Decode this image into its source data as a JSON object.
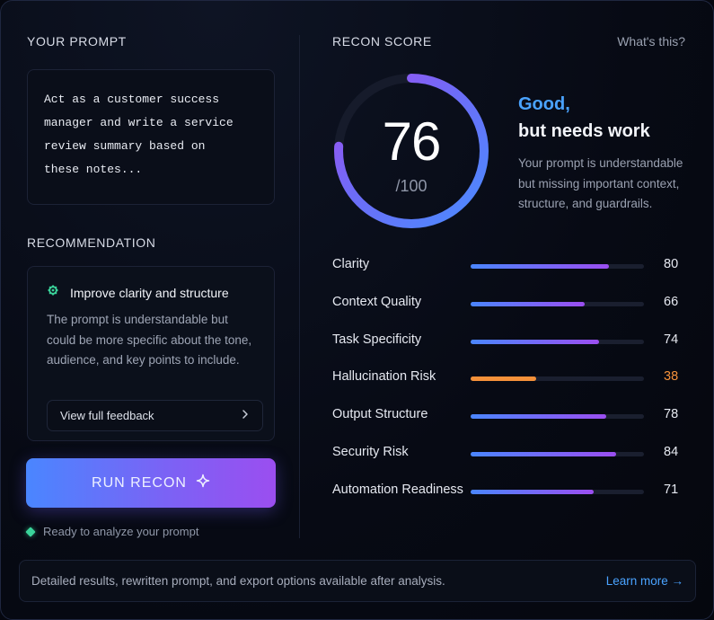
{
  "left": {
    "prompt_label": "YOUR PROMPT",
    "prompt_text": "Act as a customer success\nmanager and write a service\nreview summary based on\nthese notes...",
    "recommendation_label": "RECOMMENDATION",
    "rec_title": "Improve clarity and structure",
    "rec_body": "The prompt is understandable but could be more specific about the tone, audience, and key points to include.",
    "feedback_button": "View full feedback",
    "run_button": "RUN RECON",
    "status": "Ready to analyze your prompt"
  },
  "right": {
    "score_label": "RECON SCORE",
    "whats_this": "What's this?",
    "score": 76,
    "score_max": "/100",
    "verdict_line1": "Good,",
    "verdict_line2": "but needs work",
    "verdict_desc": "Your prompt is understandable but missing important context, structure, and guardrails.",
    "metrics": [
      {
        "label": "Clarity",
        "value": 80,
        "display": "80",
        "kind": "normal"
      },
      {
        "label": "Context Quality",
        "value": 66,
        "display": "66",
        "kind": "normal"
      },
      {
        "label": "Task Specificity",
        "value": 74,
        "display": "74",
        "kind": "normal"
      },
      {
        "label": "Hallucination Risk",
        "value": 38,
        "display": "38",
        "kind": "warning"
      },
      {
        "label": "Output Structure",
        "value": 78,
        "display": "78",
        "kind": "normal"
      },
      {
        "label": "Security Risk",
        "value": 84,
        "display": "84",
        "kind": "normal"
      },
      {
        "label": "Automation Readiness",
        "value": 71,
        "display": "71",
        "kind": "normal"
      }
    ]
  },
  "footer": {
    "text": "Detailed results, rewritten prompt, and export options available after analysis.",
    "link": "Learn more →"
  },
  "colors": {
    "accent_blue": "#4aa3ff",
    "gradient_start": "#4a86ff",
    "gradient_end": "#9b4ef0",
    "warning": "#f5913a",
    "status_green": "#3ad39a"
  },
  "icons": {
    "rec_icon": "sparkle-icon",
    "feedback_arrow": "chevron-right-icon",
    "run_icon": "sparkle-icon"
  }
}
